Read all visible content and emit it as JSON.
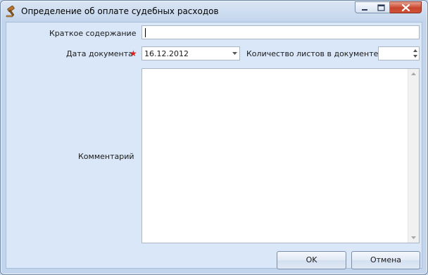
{
  "window": {
    "title": "Определение об оплате судебных расходов"
  },
  "form": {
    "summary_label": "Краткое содержание",
    "summary_value": "",
    "date_label": "Дата документа",
    "required_mark": "★",
    "date_value": "16.12.2012",
    "pages_label": "Количество листов в документе",
    "pages_value": "",
    "comment_label": "Комментарий",
    "comment_value": ""
  },
  "buttons": {
    "ok_label": "OK",
    "cancel_label": "Отмена"
  },
  "colors": {
    "required_star": "#e0201b",
    "close_button": "#c8452d"
  },
  "icons": {
    "app": "gavel-icon",
    "minimize": "minimize-icon",
    "maximize": "maximize-icon",
    "close": "close-icon"
  }
}
